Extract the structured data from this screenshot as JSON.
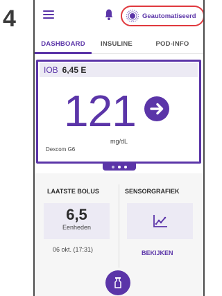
{
  "step": {
    "number": "4"
  },
  "header": {
    "mode_label": "Geautomatiseerd",
    "highlight_color": "#e0393e",
    "accent_color": "#5b35a8"
  },
  "tabs": [
    {
      "label": "DASHBOARD",
      "active": true
    },
    {
      "label": "INSULINE",
      "active": false
    },
    {
      "label": "POD-INFO",
      "active": false
    }
  ],
  "dashboard": {
    "iob_label": "IOB",
    "iob_value": "6,45 E",
    "glucose_value": "121",
    "glucose_unit": "mg/dL",
    "trend": "arrow-right-icon",
    "sensor_name": "Dexcom G6",
    "pager": {
      "pages": 3,
      "active_index": 0
    }
  },
  "last_bolus": {
    "title": "LAATSTE BOLUS",
    "value": "6,5",
    "unit": "Eenheden",
    "time": "06 okt. (17:31)"
  },
  "sensor_graph": {
    "title": "SENSORGRAFIEK",
    "link_label": "BEKIJKEN",
    "icon": "line-chart-icon"
  },
  "fab": {
    "icon": "bolus-icon"
  }
}
